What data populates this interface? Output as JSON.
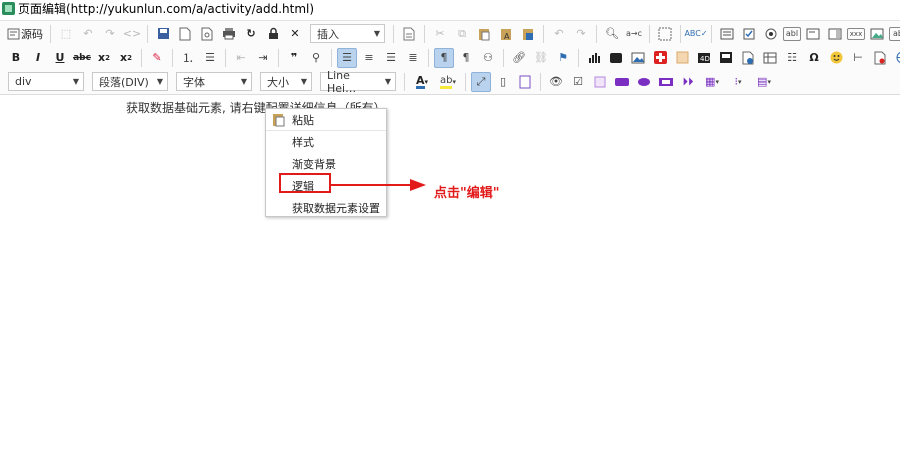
{
  "window": {
    "title": "页面编辑(http://yukunlun.com/a/activity/add.html)"
  },
  "toolbar": {
    "source_label": "源码",
    "insert_label": "插入",
    "div_label": "div",
    "paragraph_label": "段落(DIV)",
    "font_label": "字体",
    "size_label": "大小",
    "line_height_label": "Line Hei…",
    "colors": {
      "accent": "#2f6db3",
      "active": "#b9d3ee",
      "red": "#e21a1a"
    }
  },
  "content": {
    "text": "获取数据基础元素, 请右键配置详细信息（所有）"
  },
  "context_menu": {
    "items": [
      {
        "label": "粘贴"
      },
      {
        "label": "样式"
      },
      {
        "label": "渐变背景"
      },
      {
        "label": "逻辑"
      },
      {
        "label": "获取数据元素设置"
      }
    ]
  },
  "annotation": {
    "callout": "点击\"编辑\""
  }
}
